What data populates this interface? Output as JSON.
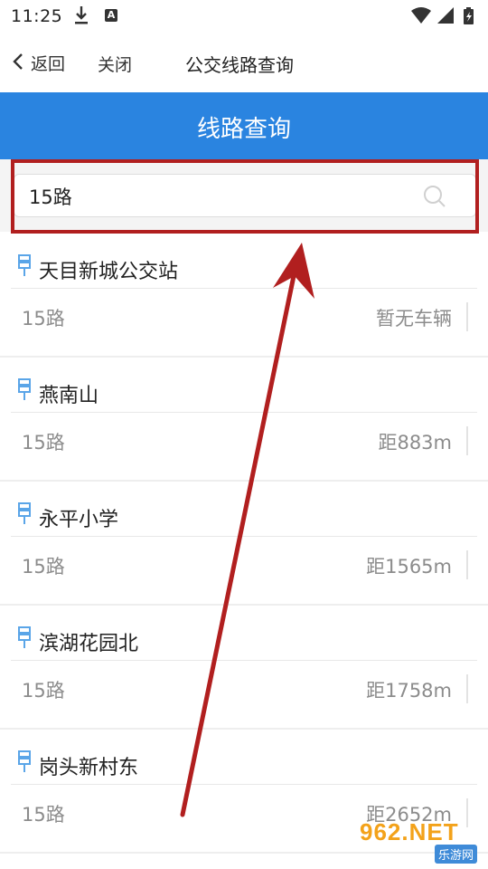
{
  "status_bar": {
    "time": "11:25",
    "icons": [
      "download-icon",
      "a-icon",
      "wifi-icon",
      "signal-icon",
      "battery-icon"
    ]
  },
  "nav": {
    "back_label": "返回",
    "close_label": "关闭",
    "title": "公交线路查询"
  },
  "header": {
    "title": "线路查询"
  },
  "search": {
    "value": "15路",
    "placeholder": ""
  },
  "stations": [
    {
      "name": "天目新城公交站",
      "route": "15路",
      "info": "暂无车辆"
    },
    {
      "name": "燕南山",
      "route": "15路",
      "info": "距883m"
    },
    {
      "name": "永平小学",
      "route": "15路",
      "info": "距1565m"
    },
    {
      "name": "滨湖花园北",
      "route": "15路",
      "info": "距1758m"
    },
    {
      "name": "岗头新村东",
      "route": "15路",
      "info": "距2652m"
    }
  ],
  "watermark": {
    "main": "962.NET",
    "sub": "乐游网"
  },
  "colors": {
    "header": "#2a84e0",
    "annotation": "#b11f1f"
  }
}
